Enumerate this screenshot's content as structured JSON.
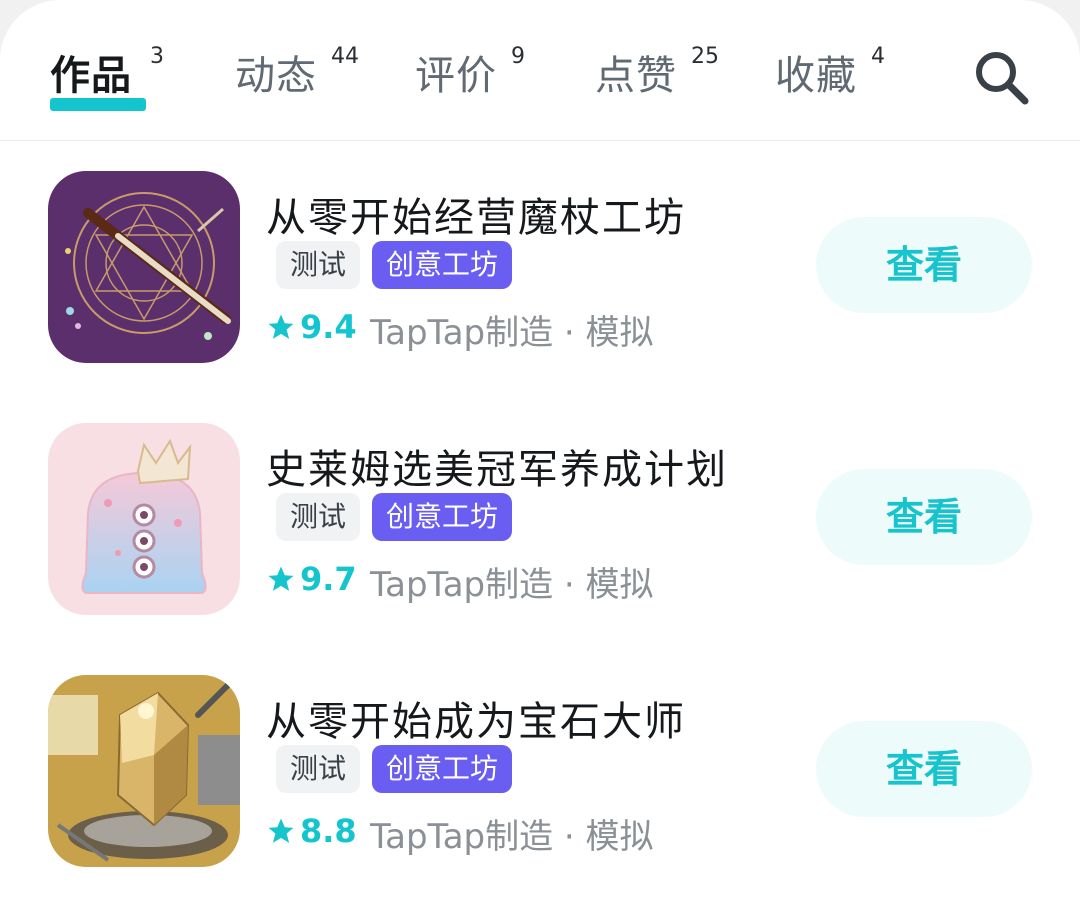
{
  "tabs": [
    {
      "label": "作品",
      "count": "3"
    },
    {
      "label": "动态",
      "count": "44"
    },
    {
      "label": "评价",
      "count": "9"
    },
    {
      "label": "点赞",
      "count": "25"
    },
    {
      "label": "收藏",
      "count": "4"
    }
  ],
  "search_icon": "search-icon",
  "accent_color": "#15c5ce",
  "items": [
    {
      "title": "从零开始经营魔杖工坊",
      "tag_test": "测试",
      "tag_workshop": "创意工坊",
      "score": "9.4",
      "maker": "TapTap制造 · 模拟",
      "action": "查看",
      "icon": "magic-wand-icon"
    },
    {
      "title": "史莱姆选美冠军养成计划",
      "tag_test": "测试",
      "tag_workshop": "创意工坊",
      "score": "9.7",
      "maker": "TapTap制造 · 模拟",
      "action": "查看",
      "icon": "crowned-slime-icon"
    },
    {
      "title": "从零开始成为宝石大师",
      "tag_test": "测试",
      "tag_workshop": "创意工坊",
      "score": "8.8",
      "maker": "TapTap制造 · 模拟",
      "action": "查看",
      "icon": "gemstone-icon"
    }
  ]
}
